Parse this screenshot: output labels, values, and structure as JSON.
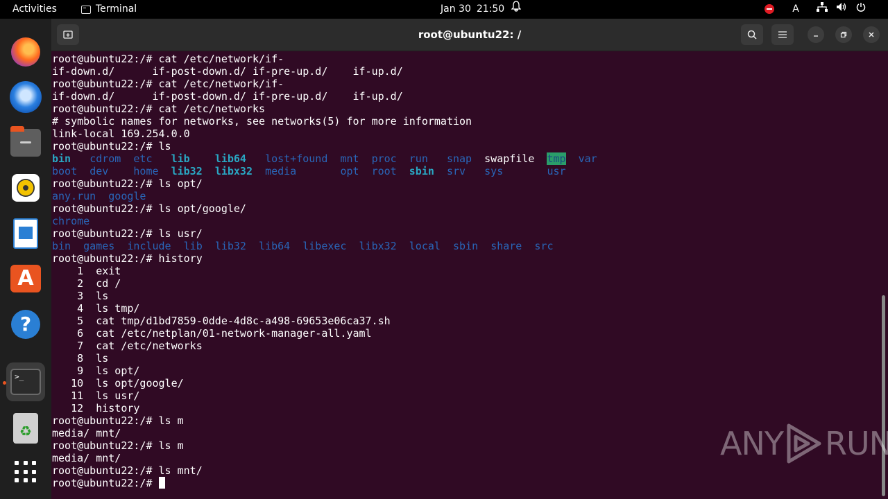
{
  "topbar": {
    "activities": "Activities",
    "app_name": "Terminal",
    "date": "Jan 30",
    "time": "21:50",
    "input_indicator": "A"
  },
  "dock": {
    "items": [
      "firefox-icon",
      "thunderbird-icon",
      "files-icon",
      "rhythmbox-icon",
      "writer-icon",
      "app-center-icon",
      "help-icon",
      "terminal-icon",
      "trash-icon",
      "show-apps-icon"
    ]
  },
  "window": {
    "title": "root@ubuntu22: /"
  },
  "terminal": {
    "lines": [
      [
        {
          "t": "root@ubuntu22:/# cat /etc/network/if-"
        }
      ],
      [
        {
          "t": "if-down.d/      if-post-down.d/ if-pre-up.d/    if-up.d/"
        }
      ],
      [
        {
          "t": "root@ubuntu22:/# cat /etc/network/if-"
        }
      ],
      [
        {
          "t": "if-down.d/      if-post-down.d/ if-pre-up.d/    if-up.d/"
        }
      ],
      [
        {
          "t": "root@ubuntu22:/# cat /etc/networks"
        }
      ],
      [
        {
          "t": "# symbolic names for networks, see networks(5) for more information"
        }
      ],
      [
        {
          "t": "link-local 169.254.0.0"
        }
      ],
      [
        {
          "t": "root@ubuntu22:/# ls"
        }
      ],
      [
        {
          "t": "bin",
          "c": "dirb"
        },
        {
          "t": "   "
        },
        {
          "t": "cdrom",
          "c": "dir"
        },
        {
          "t": "  "
        },
        {
          "t": "etc",
          "c": "dir"
        },
        {
          "t": "   "
        },
        {
          "t": "lib",
          "c": "dirb"
        },
        {
          "t": "    "
        },
        {
          "t": "lib64",
          "c": "dirb"
        },
        {
          "t": "   "
        },
        {
          "t": "lost+found",
          "c": "dir"
        },
        {
          "t": "  "
        },
        {
          "t": "mnt",
          "c": "dir"
        },
        {
          "t": "  "
        },
        {
          "t": "proc",
          "c": "dir"
        },
        {
          "t": "  "
        },
        {
          "t": "run",
          "c": "dir"
        },
        {
          "t": "   "
        },
        {
          "t": "snap",
          "c": "dir"
        },
        {
          "t": "  "
        },
        {
          "t": "swapfile"
        },
        {
          "t": "  "
        },
        {
          "t": "tmp",
          "c": "hl"
        },
        {
          "t": "  "
        },
        {
          "t": "var",
          "c": "dir"
        }
      ],
      [
        {
          "t": "boot",
          "c": "dir"
        },
        {
          "t": "  "
        },
        {
          "t": "dev",
          "c": "dir"
        },
        {
          "t": "    "
        },
        {
          "t": "home",
          "c": "dir"
        },
        {
          "t": "  "
        },
        {
          "t": "lib32",
          "c": "dirb"
        },
        {
          "t": "  "
        },
        {
          "t": "libx32",
          "c": "dirb"
        },
        {
          "t": "  "
        },
        {
          "t": "media",
          "c": "dir"
        },
        {
          "t": "       "
        },
        {
          "t": "opt",
          "c": "dir"
        },
        {
          "t": "  "
        },
        {
          "t": "root",
          "c": "dir"
        },
        {
          "t": "  "
        },
        {
          "t": "sbin",
          "c": "dirb"
        },
        {
          "t": "  "
        },
        {
          "t": "srv",
          "c": "dir"
        },
        {
          "t": "   "
        },
        {
          "t": "sys",
          "c": "dir"
        },
        {
          "t": "       "
        },
        {
          "t": "usr",
          "c": "dir"
        }
      ],
      [
        {
          "t": "root@ubuntu22:/# ls opt/"
        }
      ],
      [
        {
          "t": "any.run",
          "c": "dir"
        },
        {
          "t": "  "
        },
        {
          "t": "google",
          "c": "dir"
        }
      ],
      [
        {
          "t": "root@ubuntu22:/# ls opt/google/"
        }
      ],
      [
        {
          "t": "chrome",
          "c": "dir"
        }
      ],
      [
        {
          "t": "root@ubuntu22:/# ls usr/"
        }
      ],
      [
        {
          "t": "bin",
          "c": "dir"
        },
        {
          "t": "  "
        },
        {
          "t": "games",
          "c": "dir"
        },
        {
          "t": "  "
        },
        {
          "t": "include",
          "c": "dir"
        },
        {
          "t": "  "
        },
        {
          "t": "lib",
          "c": "dir"
        },
        {
          "t": "  "
        },
        {
          "t": "lib32",
          "c": "dir"
        },
        {
          "t": "  "
        },
        {
          "t": "lib64",
          "c": "dir"
        },
        {
          "t": "  "
        },
        {
          "t": "libexec",
          "c": "dir"
        },
        {
          "t": "  "
        },
        {
          "t": "libx32",
          "c": "dir"
        },
        {
          "t": "  "
        },
        {
          "t": "local",
          "c": "dir"
        },
        {
          "t": "  "
        },
        {
          "t": "sbin",
          "c": "dir"
        },
        {
          "t": "  "
        },
        {
          "t": "share",
          "c": "dir"
        },
        {
          "t": "  "
        },
        {
          "t": "src",
          "c": "dir"
        }
      ],
      [
        {
          "t": "root@ubuntu22:/# history"
        }
      ],
      [
        {
          "t": "    1  exit"
        }
      ],
      [
        {
          "t": "    2  cd /"
        }
      ],
      [
        {
          "t": "    3  ls"
        }
      ],
      [
        {
          "t": "    4  ls tmp/"
        }
      ],
      [
        {
          "t": "    5  cat tmp/d1bd7859-0dde-4d8c-a498-69653e06ca37.sh"
        }
      ],
      [
        {
          "t": "    6  cat /etc/netplan/01-network-manager-all.yaml"
        }
      ],
      [
        {
          "t": "    7  cat /etc/networks"
        }
      ],
      [
        {
          "t": "    8  ls"
        }
      ],
      [
        {
          "t": "    9  ls opt/"
        }
      ],
      [
        {
          "t": "   10  ls opt/google/"
        }
      ],
      [
        {
          "t": "   11  ls usr/"
        }
      ],
      [
        {
          "t": "   12  history"
        }
      ],
      [
        {
          "t": "root@ubuntu22:/# ls m"
        }
      ],
      [
        {
          "t": "media/ mnt/"
        }
      ],
      [
        {
          "t": "root@ubuntu22:/# ls m"
        }
      ],
      [
        {
          "t": "media/ mnt/"
        }
      ],
      [
        {
          "t": "root@ubuntu22:/# ls mnt/"
        }
      ],
      [
        {
          "t": "root@ubuntu22:/# "
        },
        {
          "cursor": true
        }
      ]
    ]
  },
  "watermark": {
    "left": "ANY",
    "right": "RUN"
  },
  "colors": {
    "terminal_bg": "#300a24",
    "dir": "#2966b8",
    "dir_bold": "#29a8c4",
    "highlight_bg": "#2a9d6a",
    "accent": "#e95420"
  }
}
